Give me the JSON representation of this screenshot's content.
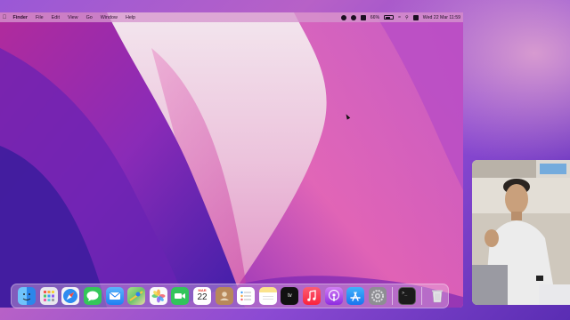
{
  "colors": {
    "menubar_bg": "#d696ce",
    "wallpaper_pink": "#e25fb8",
    "wallpaper_purple": "#5a22b5",
    "wallpaper_light": "#f0dbe8"
  },
  "menubar": {
    "apple_icon": "apple-icon",
    "app_name": "Finder",
    "menus": [
      "File",
      "Edit",
      "View",
      "Go",
      "Window",
      "Help"
    ],
    "battery_percent": "66%",
    "datetime": "Wed 22 Mar  11:59"
  },
  "dock": {
    "apps": [
      {
        "name": "finder-icon",
        "color": "#3aa3f5"
      },
      {
        "name": "launchpad-icon",
        "color": "#e8e8ee"
      },
      {
        "name": "safari-icon",
        "color": "#2d8cf0"
      },
      {
        "name": "messages-icon",
        "color": "#34c759"
      },
      {
        "name": "mail-icon",
        "color": "#2a8cf5"
      },
      {
        "name": "maps-icon",
        "color": "#6cc46a"
      },
      {
        "name": "photos-icon",
        "color": "#f7f7f7"
      },
      {
        "name": "facetime-icon",
        "color": "#32c45a"
      },
      {
        "name": "calendar-icon",
        "color": "#ffffff"
      },
      {
        "name": "contacts-icon",
        "color": "#b8885a"
      },
      {
        "name": "reminders-icon",
        "color": "#ffffff"
      },
      {
        "name": "notes-icon",
        "color": "#fbe38c"
      },
      {
        "name": "apple-tv-icon",
        "color": "#111111"
      },
      {
        "name": "music-icon",
        "color": "#fb3c55"
      },
      {
        "name": "podcasts-icon",
        "color": "#b152e8"
      },
      {
        "name": "app-store-icon",
        "color": "#1e8ef5"
      },
      {
        "name": "system-settings-icon",
        "color": "#8e8e93"
      }
    ],
    "calendar": {
      "month": "MAR",
      "day": "22"
    },
    "apple_tv_label": "tv",
    "recent": [
      {
        "name": "terminal-icon",
        "color": "#1b1b1b"
      }
    ],
    "trash": {
      "name": "trash-icon",
      "color": "#e6e6ea"
    }
  }
}
